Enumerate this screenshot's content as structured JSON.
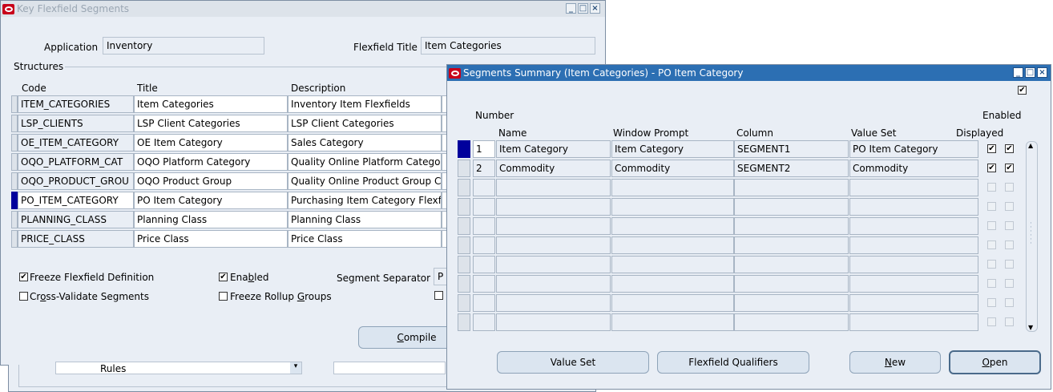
{
  "left_window": {
    "title": "Key Flexfield Segments",
    "application_label": "Application",
    "application_value": "Inventory",
    "flexfield_title_label": "Flexfield Title",
    "flexfield_title_value": "Item Categories",
    "structures_label": "Structures",
    "col_code": "Code",
    "col_title": "Title",
    "col_description": "Description",
    "rows": [
      {
        "code": "ITEM_CATEGORIES",
        "title": "Item Categories",
        "desc": "Inventory Item Flexfields"
      },
      {
        "code": "LSP_CLIENTS",
        "title": "LSP Client Categories",
        "desc": "LSP Client Categories"
      },
      {
        "code": "OE_ITEM_CATEGORY",
        "title": "OE Item Category",
        "desc": "Sales Category"
      },
      {
        "code": "OQO_PLATFORM_CAT",
        "title": "OQO Platform Category",
        "desc": "Quality Online Platform Category"
      },
      {
        "code": "OQO_PRODUCT_GROU",
        "title": "OQO Product Group",
        "desc": "Quality Online Product Group Ca"
      },
      {
        "code": "PO_ITEM_CATEGORY",
        "title": "PO Item Category",
        "desc": "Purchasing Item Category Flexfie"
      },
      {
        "code": "PLANNING_CLASS",
        "title": "Planning Class",
        "desc": "Planning Class"
      },
      {
        "code": "PRICE_CLASS",
        "title": "Price Class",
        "desc": "Price Class"
      }
    ],
    "freeze_def_pre": "Freeze Flexfield Definition",
    "enabled_pre": "Ena",
    "enabled_u": "b",
    "enabled_post": "led",
    "segment_separator_label": "Segment Separator",
    "segment_separator_value": "P",
    "cross_pre": "Cr",
    "cross_u": "o",
    "cross_post": "ss-Validate Segments",
    "freeze_rollup_pre": "Freeze Rollup ",
    "freeze_rollup_u": "G",
    "freeze_rollup_post": "roups",
    "compile_u": "C",
    "compile_post": "ompile",
    "rules_label": "Rules"
  },
  "right_window": {
    "title": "Segments Summary (Item Categories) - PO Item Category",
    "col_number": "Number",
    "col_name": "Name",
    "col_window_prompt": "Window Prompt",
    "col_column": "Column",
    "col_value_set": "Value Set",
    "col_enabled": "Enabled",
    "col_displayed": "Displayed",
    "rows": [
      {
        "number": "1",
        "name": "Item Category",
        "prompt": "Item Category",
        "column": "SEGMENT1",
        "value_set": "PO Item Category",
        "displayed": true,
        "enabled": true
      },
      {
        "number": "2",
        "name": "Commodity",
        "prompt": "Commodity",
        "column": "SEGMENT2",
        "value_set": "Commodity",
        "displayed": true,
        "enabled": true
      }
    ],
    "empty_rows": 8,
    "btn_value_set": "Value Set",
    "btn_qualifiers": "Flexfield Qualifiers",
    "btn_new_u": "N",
    "btn_new_post": "ew",
    "btn_open_u": "O",
    "btn_open_post": "pen"
  }
}
